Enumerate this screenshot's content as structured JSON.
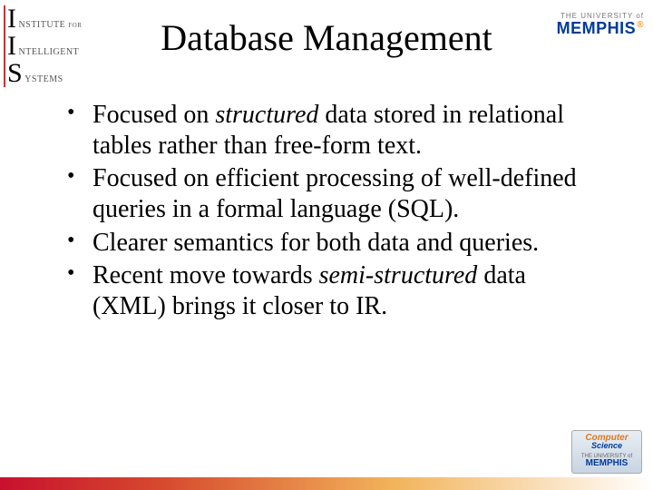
{
  "logos": {
    "iis": {
      "line1_big": "I",
      "line1_small": "NSTITUTE for",
      "line2_big": "I",
      "line2_small": "NTELLIGENT",
      "line3_big": "S",
      "line3_small": "YSTEMS"
    },
    "memphis": {
      "line1": "THE UNIVERSITY of",
      "line2": "MEMPHIS"
    },
    "cs_badge": {
      "line1": "Computer",
      "line2": "Science",
      "line3": "THE UNIVERSITY of",
      "line4": "MEMPHIS"
    }
  },
  "title": "Database Management",
  "bullets": [
    {
      "segments": [
        {
          "t": "Focused on "
        },
        {
          "t": "structured",
          "ital": true
        },
        {
          "t": " data stored in relational tables rather than free-form text."
        }
      ]
    },
    {
      "segments": [
        {
          "t": "Focused on efficient processing of well-defined queries in a formal language (SQL)."
        }
      ]
    },
    {
      "segments": [
        {
          "t": "Clearer semantics for both data and queries."
        }
      ]
    },
    {
      "segments": [
        {
          "t": "Recent move towards "
        },
        {
          "t": "semi-structured",
          "ital": true
        },
        {
          "t": " data (XML) brings it closer to IR."
        }
      ]
    }
  ]
}
